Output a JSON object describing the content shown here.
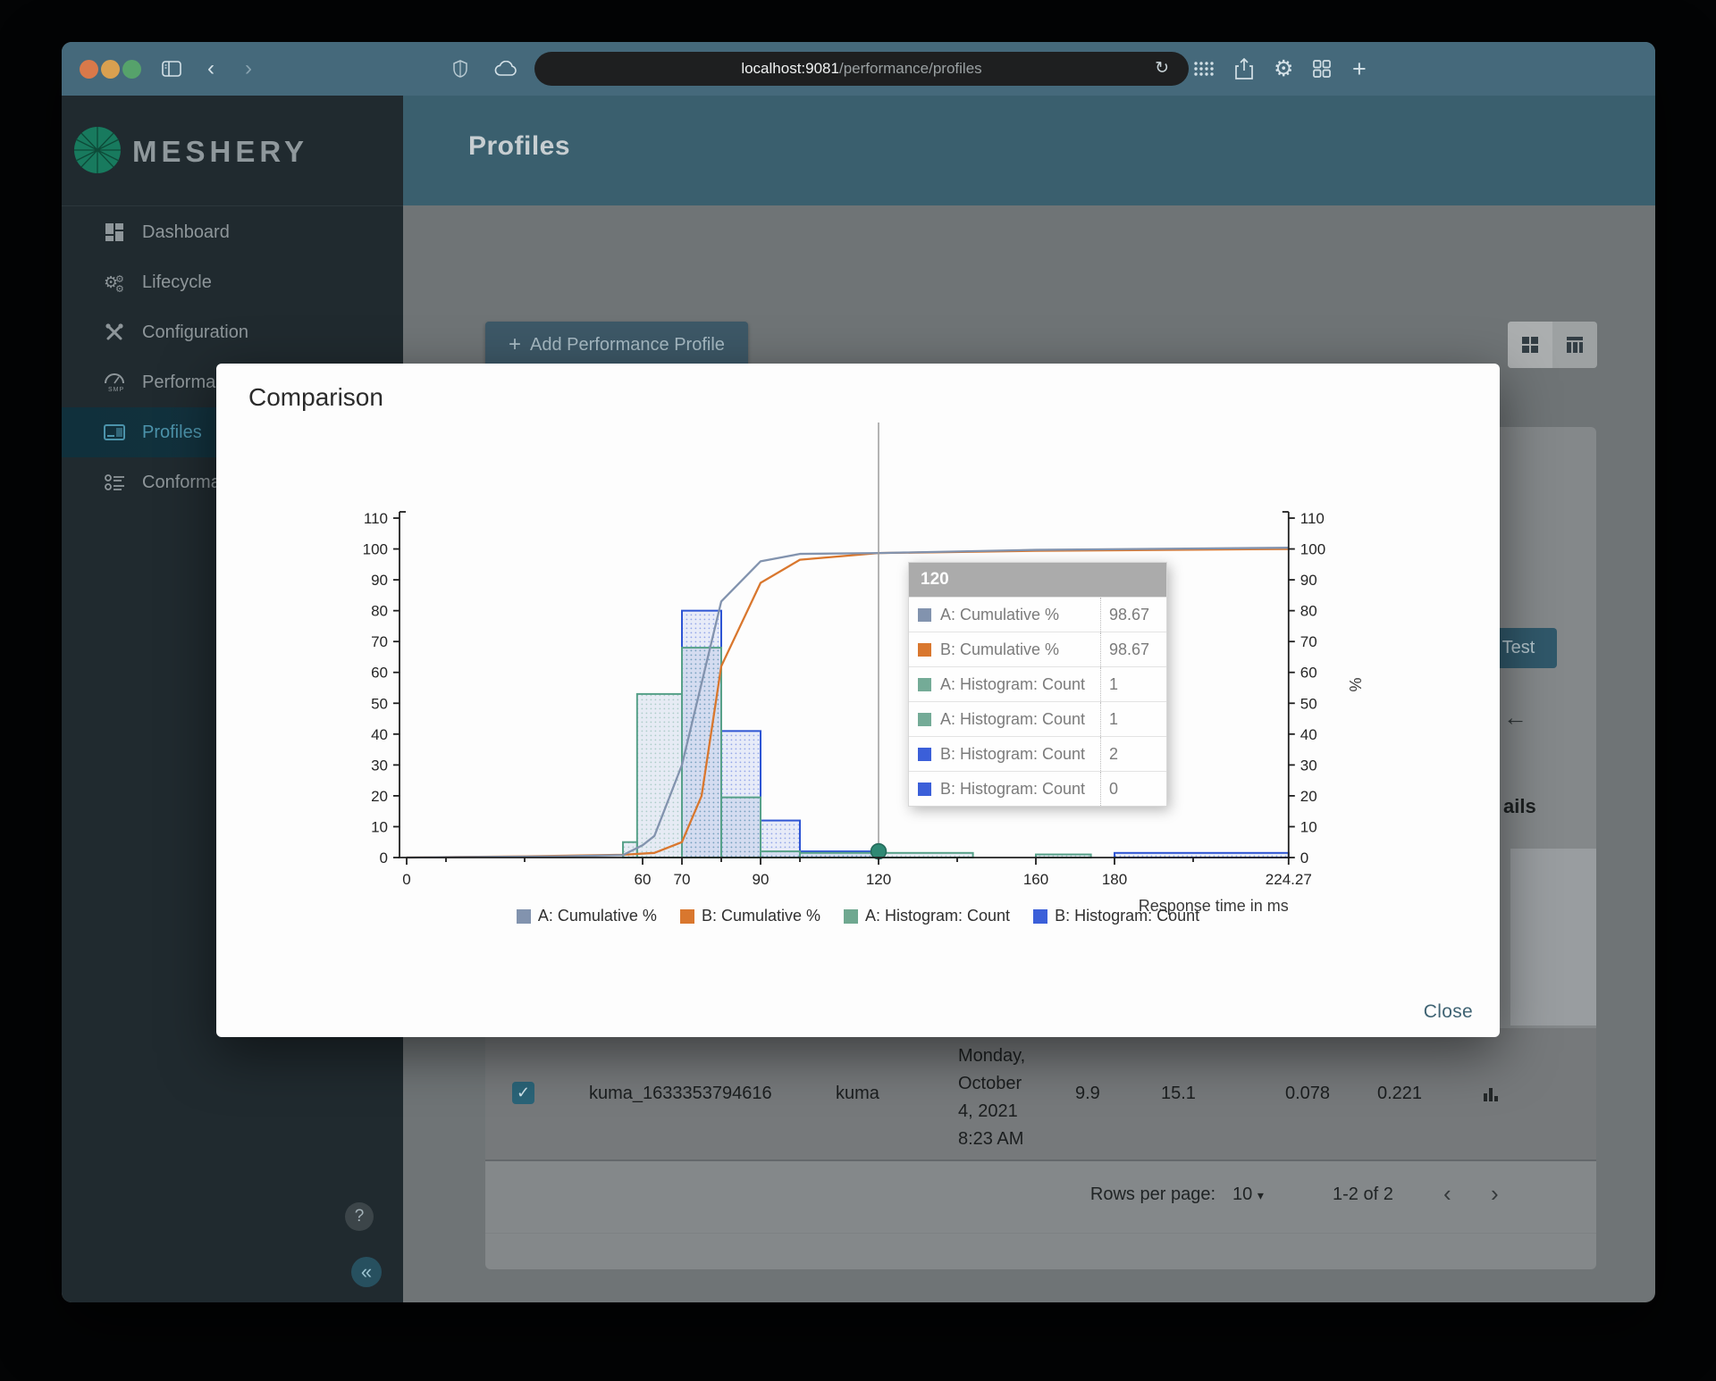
{
  "browser": {
    "url_host": "localhost:9081",
    "url_path": "/performance/profiles",
    "traffic_lights": [
      "#d9794a",
      "#d9a050",
      "#56a26b"
    ]
  },
  "app": {
    "brand": "MESHERY",
    "page_title": "Profiles",
    "sidebar": {
      "items": [
        {
          "label": "Dashboard",
          "icon": "dashboard-icon",
          "active": false
        },
        {
          "label": "Lifecycle",
          "icon": "lifecycle-icon",
          "active": false
        },
        {
          "label": "Configuration",
          "icon": "configuration-icon",
          "active": false
        },
        {
          "label": "Performance",
          "icon": "performance-icon",
          "active": false
        },
        {
          "label": "Profiles",
          "icon": "profiles-icon",
          "active": true
        },
        {
          "label": "Conformance",
          "icon": "conformance-icon",
          "active": false
        }
      ]
    },
    "help_label": "?",
    "collapse_label": "«"
  },
  "content": {
    "add_profile_button": "Add Performance Profile",
    "test_button": "Test",
    "details_fragment": "ails",
    "profile_row": {
      "name": "kuma_1633353794616",
      "mesh": "kuma",
      "date_lines": [
        "Monday,",
        "October",
        "4, 2021",
        "8:23 AM"
      ],
      "values": [
        "9.9",
        "15.1",
        "0.078",
        "0.221"
      ]
    },
    "pagination": {
      "rows_per_page_label": "Rows per page:",
      "rows_per_page": "10",
      "range": "1-2 of 2",
      "prev": "‹",
      "next": "›"
    }
  },
  "modal": {
    "title": "Comparison",
    "close_label": "Close"
  },
  "chart_data": {
    "type": "histogram+cumulative-line",
    "xlabel": "Response time in ms",
    "right_axis_label": "%",
    "xlim": [
      0,
      226
    ],
    "ylim": [
      0,
      110
    ],
    "y_ticks": [
      0,
      10,
      20,
      30,
      40,
      50,
      60,
      70,
      80,
      90,
      100,
      110
    ],
    "x_major_ticks": [
      {
        "v": 0,
        "label": "0"
      },
      {
        "v": 60,
        "label": "60"
      },
      {
        "v": 70,
        "label": "70"
      },
      {
        "v": 90,
        "label": "90"
      },
      {
        "v": 120,
        "label": "120"
      },
      {
        "v": 160,
        "label": "160"
      },
      {
        "v": 180,
        "label": "180"
      },
      {
        "v": 224.27,
        "label": "224.27"
      }
    ],
    "x_minor_ticks": [
      10,
      30,
      80,
      100,
      140,
      200
    ],
    "series": [
      {
        "name": "B: Histogram: Count",
        "type": "bars",
        "color": "#2e55d4",
        "bins": [
          [
            70,
            80,
            80
          ],
          [
            80,
            90,
            41
          ],
          [
            90,
            100,
            12
          ],
          [
            100,
            121,
            2
          ],
          [
            180,
            224.27,
            1.5
          ]
        ]
      },
      {
        "name": "A: Histogram: Count",
        "type": "bars",
        "color": "#57a189",
        "bins": [
          [
            55,
            58.6,
            5
          ],
          [
            58.6,
            70,
            53
          ],
          [
            70,
            80,
            68
          ],
          [
            80,
            90,
            19.5
          ],
          [
            90,
            100,
            2
          ],
          [
            100,
            144,
            1.5
          ],
          [
            160,
            174,
            1
          ]
        ]
      },
      {
        "name": "B: Cumulative %",
        "type": "line",
        "color": "#d9772e",
        "points": [
          [
            0,
            0
          ],
          [
            30,
            0.4
          ],
          [
            55,
            0.9
          ],
          [
            63,
            1.5
          ],
          [
            70,
            5
          ],
          [
            75,
            20
          ],
          [
            80,
            62
          ],
          [
            90,
            89
          ],
          [
            100,
            96.5
          ],
          [
            120,
            98.67
          ],
          [
            160,
            99.4
          ],
          [
            224.27,
            100
          ]
        ]
      },
      {
        "name": "A: Cumulative %",
        "type": "line",
        "color": "#8293ae",
        "points": [
          [
            0,
            0
          ],
          [
            40,
            0.4
          ],
          [
            55,
            0.8
          ],
          [
            60,
            4
          ],
          [
            63,
            7
          ],
          [
            70,
            30
          ],
          [
            80,
            83
          ],
          [
            90,
            96
          ],
          [
            100,
            98.4
          ],
          [
            120,
            98.67
          ],
          [
            160,
            99.7
          ],
          [
            224.27,
            100.4
          ]
        ]
      }
    ],
    "crosshair_x": 120,
    "selected_point": {
      "x": 120,
      "y": 2,
      "color": "#2f8974"
    },
    "tooltip": {
      "header": "120",
      "rows": [
        {
          "label": "A: Cumulative %",
          "color": "#8293ae",
          "value": "98.67"
        },
        {
          "label": "B: Cumulative %",
          "color": "#d9772e",
          "value": "98.67"
        },
        {
          "label": "A: Histogram: Count",
          "color": "#74ab97",
          "value": "1"
        },
        {
          "label": "A: Histogram: Count",
          "color": "#74ab97",
          "value": "1"
        },
        {
          "label": "B: Histogram: Count",
          "color": "#3b5fd9",
          "value": "2"
        },
        {
          "label": "B: Histogram: Count",
          "color": "#3b5fd9",
          "value": "0"
        }
      ]
    },
    "legend": [
      {
        "label": "A: Cumulative %",
        "color": "#8293ae"
      },
      {
        "label": "B: Cumulative %",
        "color": "#d9772e"
      },
      {
        "label": "A: Histogram: Count",
        "color": "#6fa890"
      },
      {
        "label": "B: Histogram: Count",
        "color": "#3b5fd9"
      }
    ]
  }
}
